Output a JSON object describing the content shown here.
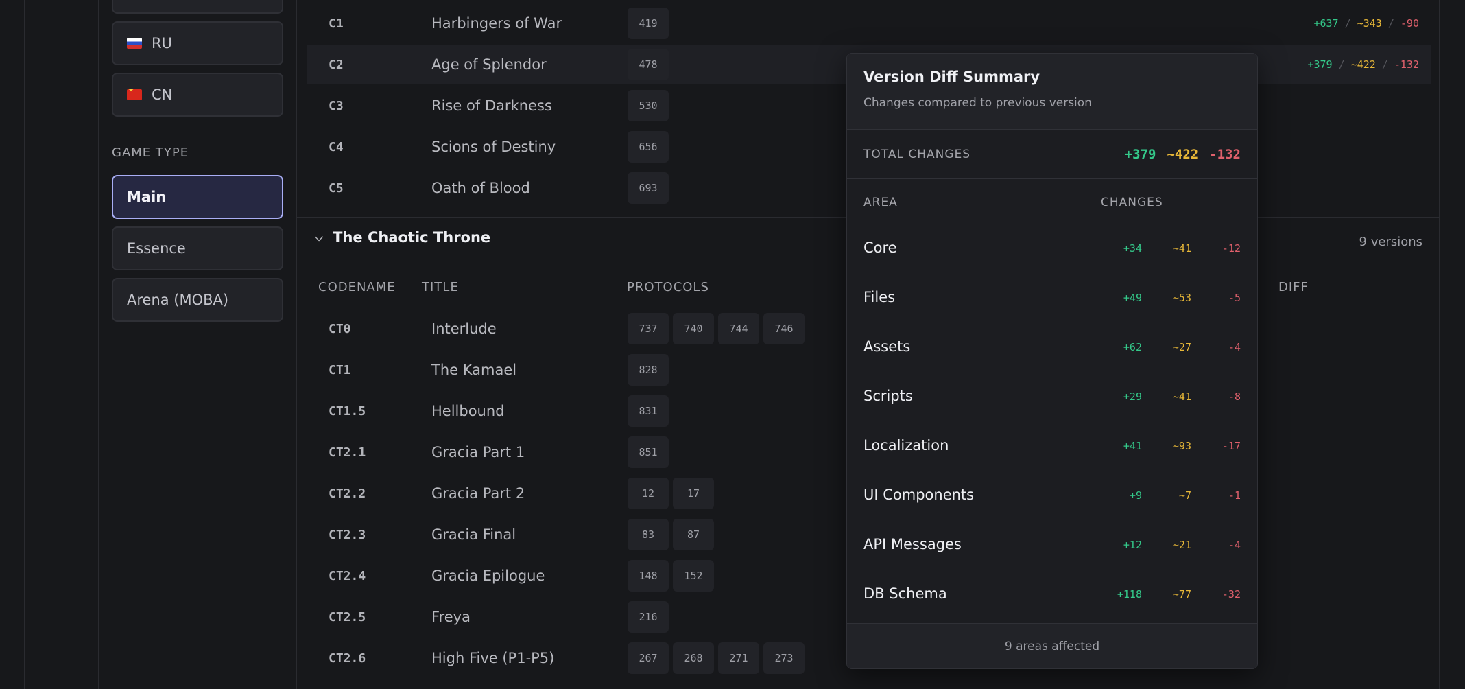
{
  "sidebar": {
    "regions": [
      {
        "code": "RU",
        "flag": "ru-flag-icon"
      },
      {
        "code": "CN",
        "flag": "cn-flag-icon"
      }
    ],
    "game_type_label": "GAME TYPE",
    "game_types": [
      {
        "label": "Main",
        "active": true
      },
      {
        "label": "Essence",
        "active": false
      },
      {
        "label": "Arena (MOBA)",
        "active": false
      }
    ]
  },
  "classic_rows": [
    {
      "codename": "C1",
      "title": "Harbingers of War",
      "protocols": [
        "419"
      ],
      "diff": {
        "added": "+637",
        "modified": "~343",
        "removed": "-90"
      }
    },
    {
      "codename": "C2",
      "title": "Age of Splendor",
      "protocols": [
        "478"
      ],
      "diff": {
        "added": "+379",
        "modified": "~422",
        "removed": "-132"
      }
    },
    {
      "codename": "C3",
      "title": "Rise of Darkness",
      "protocols": [
        "530"
      ]
    },
    {
      "codename": "C4",
      "title": "Scions of Destiny",
      "protocols": [
        "656"
      ]
    },
    {
      "codename": "C5",
      "title": "Oath of Blood",
      "protocols": [
        "693"
      ]
    }
  ],
  "group": {
    "name": "The Chaotic Throne",
    "version_count": "9 versions",
    "columns": {
      "codename": "CODENAME",
      "title": "TITLE",
      "protocols": "PROTOCOLS",
      "diff": "DIFF"
    },
    "rows": [
      {
        "codename": "CT0",
        "title": "Interlude",
        "protocols": [
          "737",
          "740",
          "744",
          "746"
        ]
      },
      {
        "codename": "CT1",
        "title": "The Kamael",
        "protocols": [
          "828"
        ]
      },
      {
        "codename": "CT1.5",
        "title": "Hellbound",
        "protocols": [
          "831"
        ]
      },
      {
        "codename": "CT2.1",
        "title": "Gracia Part 1",
        "protocols": [
          "851"
        ]
      },
      {
        "codename": "CT2.2",
        "title": "Gracia Part 2",
        "protocols": [
          "12",
          "17"
        ]
      },
      {
        "codename": "CT2.3",
        "title": "Gracia Final",
        "protocols": [
          "83",
          "87"
        ]
      },
      {
        "codename": "CT2.4",
        "title": "Gracia Epilogue",
        "protocols": [
          "148",
          "152"
        ]
      },
      {
        "codename": "CT2.5",
        "title": "Freya",
        "protocols": [
          "216"
        ]
      },
      {
        "codename": "CT2.6",
        "title": "High Five (P1-P5)",
        "protocols": [
          "267",
          "268",
          "271",
          "273"
        ]
      }
    ]
  },
  "popover": {
    "title": "Version Diff Summary",
    "subtitle": "Changes compared to previous version",
    "total_label": "TOTAL CHANGES",
    "total": {
      "added": "+379",
      "modified": "~422",
      "removed": "-132"
    },
    "area_header": "AREA",
    "changes_header": "CHANGES",
    "areas": [
      {
        "name": "Core",
        "added": "+34",
        "modified": "~41",
        "removed": "-12"
      },
      {
        "name": "Files",
        "added": "+49",
        "modified": "~53",
        "removed": "-5"
      },
      {
        "name": "Assets",
        "added": "+62",
        "modified": "~27",
        "removed": "-4"
      },
      {
        "name": "Scripts",
        "added": "+29",
        "modified": "~41",
        "removed": "-8"
      },
      {
        "name": "Localization",
        "added": "+41",
        "modified": "~93",
        "removed": "-17"
      },
      {
        "name": "UI Components",
        "added": "+9",
        "modified": "~7",
        "removed": "-1"
      },
      {
        "name": "API Messages",
        "added": "+12",
        "modified": "~21",
        "removed": "-4"
      },
      {
        "name": "DB Schema",
        "added": "+118",
        "modified": "~77",
        "removed": "-32"
      }
    ],
    "footer": "9 areas affected"
  },
  "colors": {
    "added": "#34c98a",
    "modified": "#e8b838",
    "removed": "#e0606c",
    "accent": "#a9aef5"
  }
}
